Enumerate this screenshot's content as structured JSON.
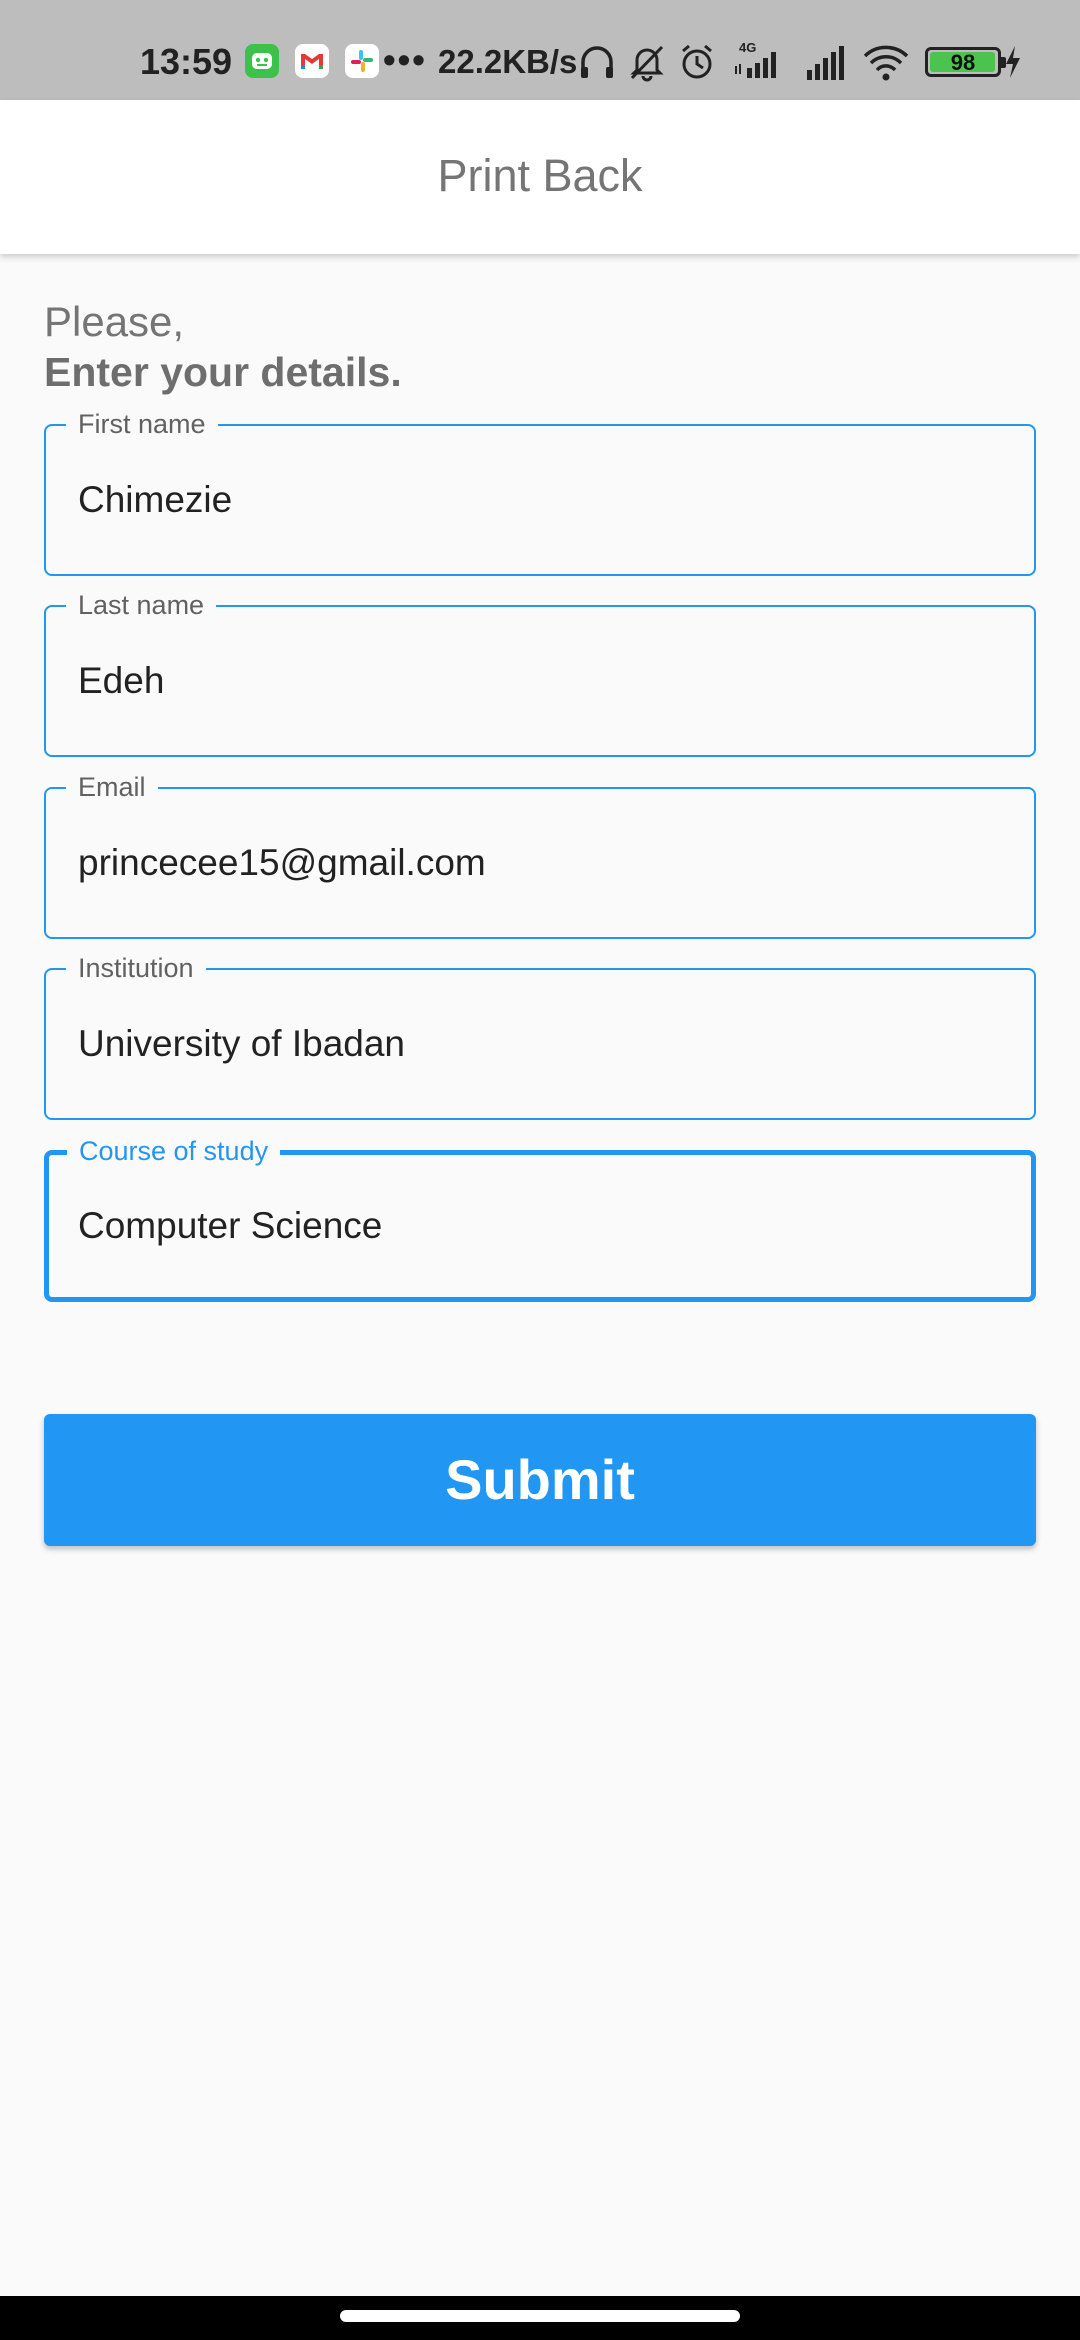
{
  "status_bar": {
    "time": "13:59",
    "network_speed": "22.2KB/s",
    "more_dots": "•••",
    "network_type": "4G",
    "battery_level": "98",
    "battery_fraction": 0.98,
    "colors": {
      "background": "#bdbdbd",
      "battery_fill": "#4cc34f"
    },
    "icons": [
      "bot-notification-icon",
      "gmail-icon",
      "slack-icon",
      "headphones-icon",
      "bell-muted-icon",
      "alarm-icon",
      "signal-4g-icon",
      "signal-icon",
      "wifi-icon",
      "battery-icon",
      "charging-icon"
    ]
  },
  "app_bar": {
    "title": "Print Back"
  },
  "greeting": {
    "line1": "Please,",
    "line2": "Enter your details."
  },
  "form": {
    "first_name": {
      "label": "First name",
      "value": "Chimezie"
    },
    "last_name": {
      "label": "Last name",
      "value": "Edeh"
    },
    "email": {
      "label": "Email",
      "value": "princecee15@gmail.com"
    },
    "institution": {
      "label": "Institution",
      "value": "University of Ibadan"
    },
    "course": {
      "label": "Course of study",
      "value": "Computer Science",
      "focused": true
    }
  },
  "submit": {
    "label": "Submit"
  },
  "colors": {
    "accent": "#2196f3",
    "background": "#fafafa",
    "label_gray": "#616161",
    "title_gray": "#757575"
  }
}
